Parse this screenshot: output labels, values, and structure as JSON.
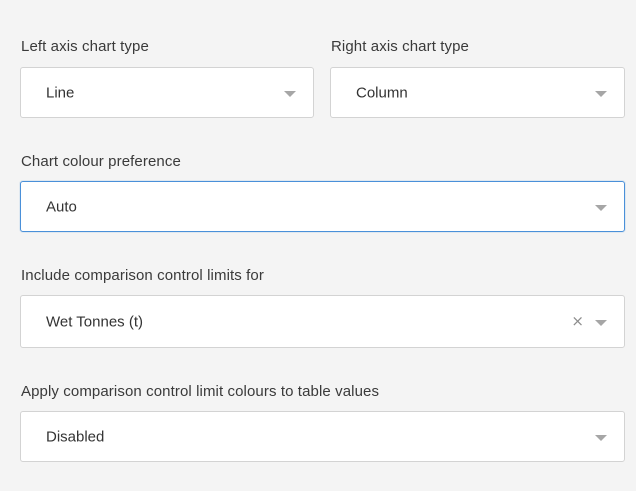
{
  "left_axis": {
    "label": "Left axis chart type",
    "value": "Line",
    "arrow_icon": "chevron-down-icon"
  },
  "right_axis": {
    "label": "Right axis chart type",
    "value": "Column",
    "arrow_icon": "chevron-down-icon"
  },
  "colour_preference": {
    "label": "Chart colour preference",
    "value": "Auto",
    "focused": true,
    "focus_color": "#4a90d9"
  },
  "comparison_limits": {
    "label": "Include comparison control limits for",
    "value": "Wet Tonnes (t)",
    "clear_symbol": "×",
    "clear_icon": "close-icon"
  },
  "limit_colours": {
    "label": "Apply comparison control limit colours to table values",
    "value": "Disabled"
  },
  "colors": {
    "background": "#f4f4f4",
    "input_background": "#ffffff",
    "input_border": "#d3d3d3",
    "arrow": "#a6a6a6",
    "text": "#333333"
  }
}
